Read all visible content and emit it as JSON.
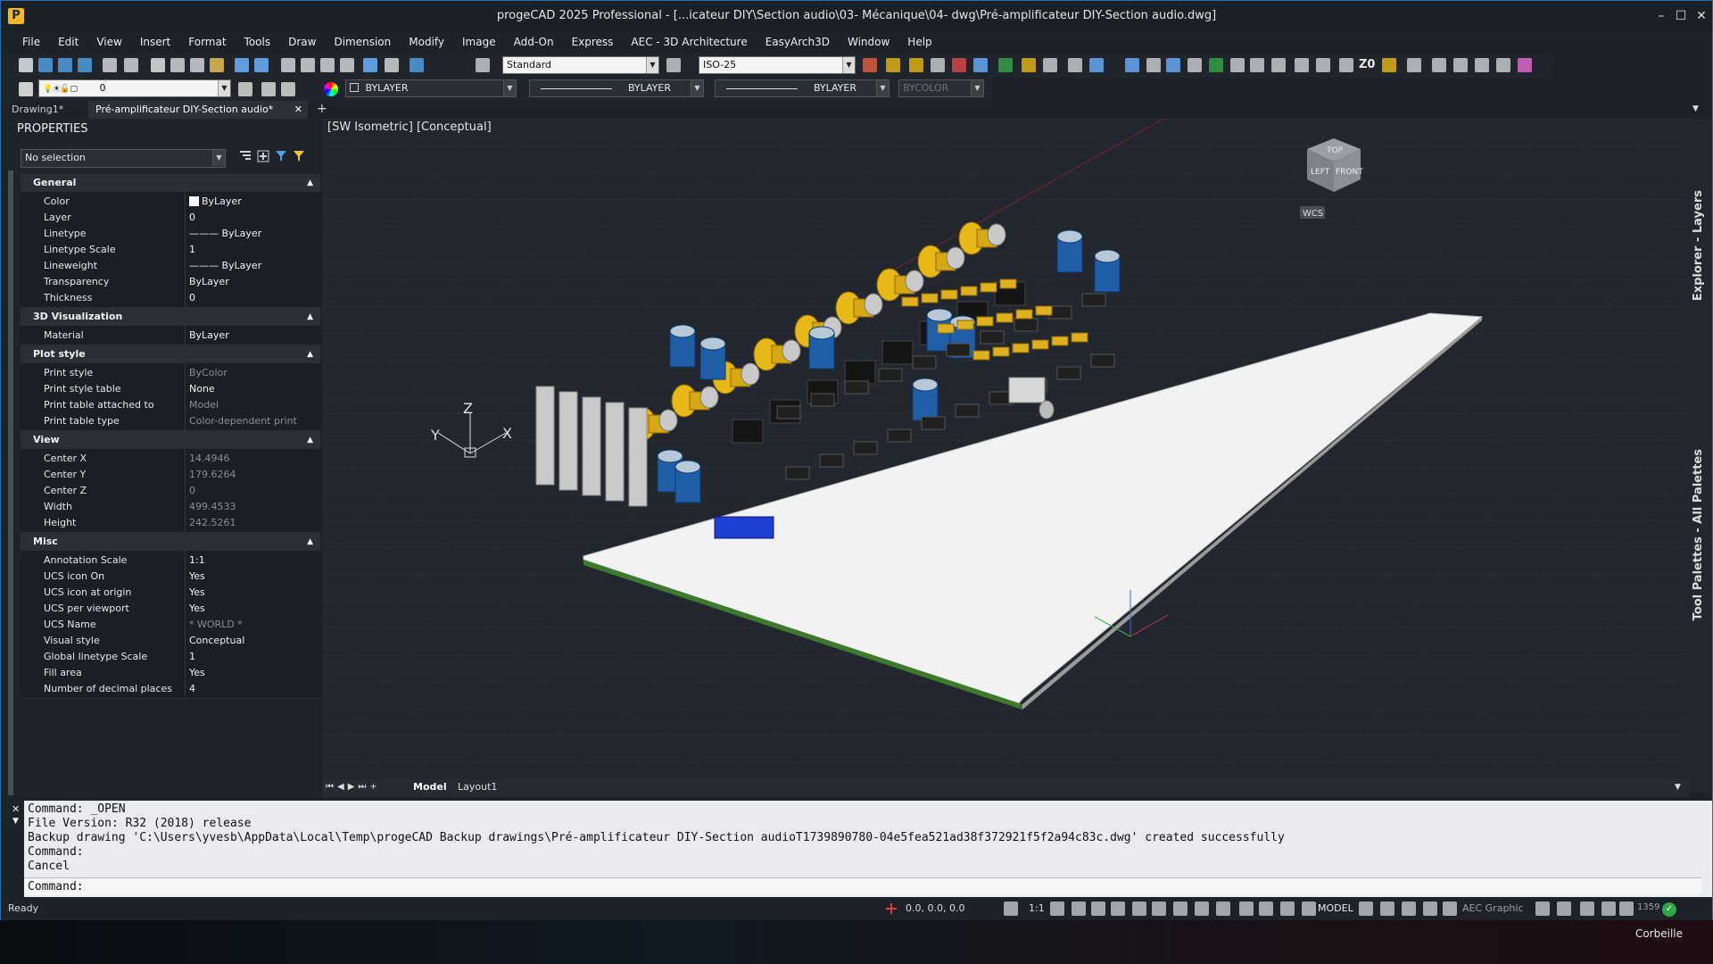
{
  "window": {
    "title": "progeCAD 2025 Professional - [...icateur DIY\\Section audio\\03- Mécanique\\04- dwg\\Pré-amplificateur DIY-Section audio.dwg]",
    "controls": {
      "minimize": "–",
      "maximize": "☐",
      "close": "✕"
    }
  },
  "menu": [
    "File",
    "Edit",
    "View",
    "Insert",
    "Format",
    "Tools",
    "Draw",
    "Dimension",
    "Modify",
    "Image",
    "Add-On",
    "Express",
    "AEC - 3D Architecture",
    "EasyArch3D",
    "Window",
    "Help"
  ],
  "toolbar": {
    "text_style": "Standard",
    "dim_style": "ISO-25",
    "z0_label": "Z0",
    "layer_value": "0",
    "color_value": "BYLAYER",
    "linetype_value": "BYLAYER",
    "lineweight_value": "BYLAYER",
    "plotstyle_value": "BYCOLOR"
  },
  "tabs": [
    {
      "label": "Drawing1*"
    },
    {
      "label": "Pré-amplificateur DIY-Section audio*"
    }
  ],
  "new_tab": "+",
  "tab_close": "✕",
  "properties": {
    "title": "PROPERTIES",
    "selection": "No selection",
    "groups": {
      "general": "General",
      "viz3d": "3D Visualization",
      "plot": "Plot style",
      "view": "View",
      "misc": "Misc"
    },
    "general": [
      {
        "k": "Color",
        "v": "ByLayer"
      },
      {
        "k": "Layer",
        "v": "0"
      },
      {
        "k": "Linetype",
        "v": "——— ByLayer"
      },
      {
        "k": "Linetype Scale",
        "v": "1"
      },
      {
        "k": "Lineweight",
        "v": "——— ByLayer"
      },
      {
        "k": "Transparency",
        "v": "ByLayer"
      },
      {
        "k": "Thickness",
        "v": "0"
      }
    ],
    "viz3d": [
      {
        "k": "Material",
        "v": "ByLayer"
      }
    ],
    "plot": [
      {
        "k": "Print style",
        "v": "ByColor"
      },
      {
        "k": "Print style table",
        "v": "None"
      },
      {
        "k": "Print table attached to",
        "v": "Model"
      },
      {
        "k": "Print table type",
        "v": "Color-dependent print style"
      }
    ],
    "view": [
      {
        "k": "Center X",
        "v": "14.4946"
      },
      {
        "k": "Center Y",
        "v": "179.6264"
      },
      {
        "k": "Center Z",
        "v": "0"
      },
      {
        "k": "Width",
        "v": "499.4533"
      },
      {
        "k": "Height",
        "v": "242.5261"
      }
    ],
    "misc": [
      {
        "k": "Annotation Scale",
        "v": "1:1"
      },
      {
        "k": "UCS icon On",
        "v": "Yes"
      },
      {
        "k": "UCS icon at origin",
        "v": "Yes"
      },
      {
        "k": "UCS per viewport",
        "v": "Yes"
      },
      {
        "k": "UCS Name",
        "v": "* WORLD *"
      },
      {
        "k": "Visual style",
        "v": "Conceptual"
      },
      {
        "k": "Global linetype Scale",
        "v": "1"
      },
      {
        "k": "Fill area",
        "v": "Yes"
      },
      {
        "k": "Number of decimal places",
        "v": "4"
      }
    ]
  },
  "viewport": {
    "label": "[SW Isometric]  [Conceptual]",
    "viewcube_top": "TOP",
    "viewcube_left": "LEFT",
    "viewcube_front": "FRONT",
    "wcs": "WCS",
    "axis_x": "X",
    "axis_y": "Y",
    "axis_z": "Z"
  },
  "side_panels": [
    "Explorer - Layers",
    "Tool Palettes - All Palettes"
  ],
  "layout_tabs": [
    "Model",
    "Layout1"
  ],
  "command_history": [
    "Command: _OPEN",
    "File Version: R32 (2018) release",
    "Backup drawing 'C:\\Users\\yvesb\\AppData\\Local\\Temp\\progeCAD Backup drawings\\Pré-amplificateur DIY-Section audioT1739890780-04e5fea521ad38f372921f5f2a94c83c.dwg' created successfully",
    "Command:",
    "Cancel"
  ],
  "command_prompt": "Command:",
  "status": {
    "ready": "Ready",
    "coords": "0.0, 0.0, 0.0",
    "scale": "1:1",
    "model": "MODEL",
    "aec": "AEC Graphic",
    "number": "1359"
  },
  "desktop": {
    "trash": "Corbeille"
  },
  "colors": {
    "accent": "#2a6fb0",
    "pcb": "#f2f2f2",
    "gold": "#e8b816",
    "capacitor": "#1f5fa8"
  }
}
